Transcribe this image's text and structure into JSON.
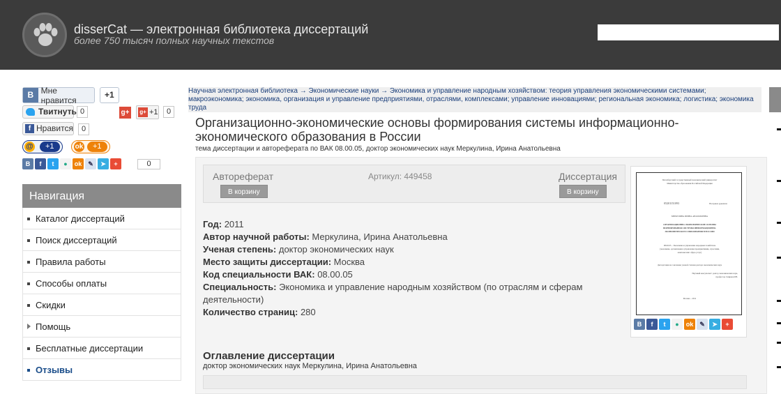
{
  "header": {
    "site_title": "disserCat — электронная библиотека диссертаций",
    "site_subtitle": "более 750 тысяч полных научных текстов",
    "search_placeholder": ""
  },
  "social": {
    "vk_label": "Мне нравится",
    "vk_count": "+1",
    "twitter_label": "Твитнуть",
    "twitter_count": "0",
    "gplus_label": "+1",
    "gplus_count": "0",
    "facebook_label": "Нравится",
    "facebook_count": "0",
    "mail_count": "+1",
    "ok_count": "+1",
    "share_count": "0"
  },
  "navigation": {
    "title": "Навигация",
    "items": [
      {
        "label": "Каталог диссертаций",
        "marker": "bullet",
        "active": false
      },
      {
        "label": "Поиск диссертаций",
        "marker": "bullet",
        "active": false
      },
      {
        "label": "Правила работы",
        "marker": "bullet",
        "active": false
      },
      {
        "label": "Способы оплаты",
        "marker": "bullet",
        "active": false
      },
      {
        "label": "Скидки",
        "marker": "bullet",
        "active": false
      },
      {
        "label": "Помощь",
        "marker": "triangle",
        "active": false
      },
      {
        "label": "Бесплатные диссертации",
        "marker": "bullet",
        "active": false
      },
      {
        "label": "Отзывы",
        "marker": "bullet",
        "active": true
      }
    ]
  },
  "breadcrumb": {
    "items": [
      "Научная электронная библиотека",
      "Экономические науки",
      "Экономика и управление народным хозяйством: теория управления экономическими системами; макроэкономика; экономика, организация и управление предприятиями, отраслями, комплексами; управление инновациями; региональная экономика; логистика; экономика труда"
    ],
    "separator": "→"
  },
  "document": {
    "title": "Организационно-экономические основы формирования системы информационно-экономического образования в России",
    "subtitle": "тема диссертации и автореферата по ВАК 08.00.05, доктор экономических наук Меркулина, Ирина Анатольевна"
  },
  "buy": {
    "abstract_label": "Автореферат",
    "abstract_button": "В корзину",
    "article_text": "Артикул: 449458",
    "dissertation_label": "Диссертация",
    "dissertation_button": "В корзину"
  },
  "info": {
    "year_label": "Год:",
    "year_value": "2011",
    "author_label": "Автор научной работы:",
    "author_value": "Меркулина, Ирина Анатольевна",
    "degree_label": "Ученая степень:",
    "degree_value": "доктор экономических наук",
    "place_label": "Место защиты диссертации:",
    "place_value": "Москва",
    "code_label": "Код специальности ВАК:",
    "code_value": "08.00.05",
    "specialty_label": "Специальность:",
    "specialty_value": "Экономика и управление народным хозяйством (по отраслям и сферам деятельности)",
    "pages_label": "Количество страниц:",
    "pages_value": "280"
  },
  "preview": {
    "lines": [
      "Петербургский государственный экономический университет",
      "Министерства образования Российской Федерации",
      "05201151093",
      "На правах рукописи",
      "МЕРКУЛИНА ИРИНА АНАТОЛЬЕВНА",
      "ОРГАНИЗАЦИОННО-ЭКОНОМИЧЕСКИЕ ОСНОВЫ",
      "ФОРМИРОВАНИЯ СИСТЕМЫ ИНФОРМАЦИОННО-",
      "ЭКОНОМИЧЕСКОГО ОБРАЗОВАНИЯ В РОССИИ",
      "08.00.05 – Экономика и управление народным хозяйством",
      "(экономика, организация и управление предприятиями, отраслями,",
      "комплексами: сфера услуг)",
      "Диссертация на соискание ученой степени доктора экономических наук",
      "Научный консультант: доктор экономических наук,",
      "профессор Смирнов Р.В.",
      "Москва – 2011"
    ]
  },
  "toc": {
    "title": "Оглавление диссертации",
    "subtitle": "доктор экономических наук Меркулина, Ирина Анатольевна"
  },
  "colors": {
    "header_bg": "#3b3b3b",
    "nav_title_bg": "#8a8a8a",
    "link": "#1a3e7a",
    "vk": "#5b7ba6",
    "facebook": "#3b5998",
    "twitter": "#2aa3ef",
    "gplus": "#dd4b39",
    "ok": "#ee8208"
  }
}
